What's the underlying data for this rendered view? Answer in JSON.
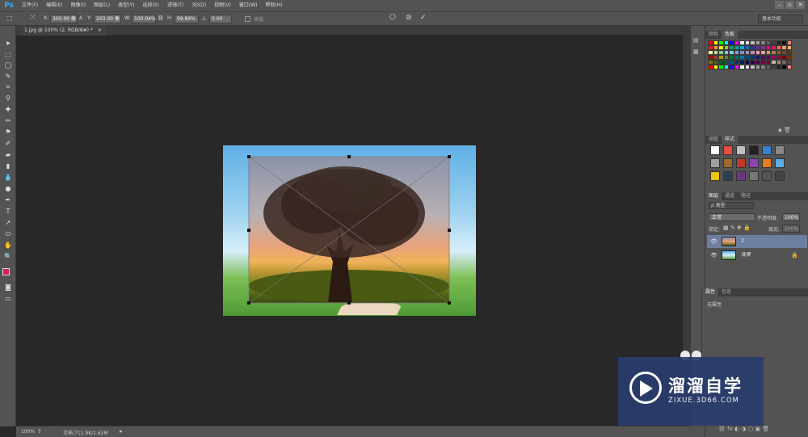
{
  "app": {
    "logo": "Ps",
    "colors": {
      "accent": "#3fa9f5",
      "chrome": "#535353",
      "canvas_bg": "#282828",
      "fg_color": "#d81b60",
      "bg_color": "#ffffff"
    }
  },
  "menu": [
    "文件(F)",
    "编辑(E)",
    "图像(I)",
    "图层(L)",
    "类型(Y)",
    "选择(S)",
    "滤镜(T)",
    "3D(D)",
    "视图(V)",
    "窗口(W)",
    "帮助(H)"
  ],
  "options": {
    "x_label": "X:",
    "x_value": "300.00 像",
    "y_label": "Y:",
    "y_value": "203.00 像",
    "w_label": "W:",
    "w_value": "100.04%",
    "h_label": "H:",
    "h_value": "99.89%",
    "angle_label": "△",
    "angle_value": "0.00",
    "interp_label": "插值",
    "workspace": "基本功能"
  },
  "document": {
    "tab": "1.jpg @ 100% (2, RGB/8#) *",
    "close": "×"
  },
  "status": {
    "zoom": "100%",
    "doc_info": "文档:711.9K/1.62M"
  },
  "panels": {
    "swatch_tabs": [
      "颜色",
      "色板"
    ],
    "style_tabs": [
      "调整",
      "样式"
    ],
    "layer_tabs": [
      "图层",
      "通道",
      "路径"
    ],
    "kind_label": "ρ 类型",
    "blend_mode": "正常",
    "opacity_label": "不透明度:",
    "opacity_value": "100%",
    "lock_label": "锁定:",
    "fill_label": "填充:",
    "fill_value": "100%",
    "layers": [
      {
        "name": "2"
      },
      {
        "name": "背景"
      }
    ],
    "props_tabs": [
      "属性",
      "信息"
    ],
    "props_text": "无属性"
  },
  "watermark": {
    "title": "溜溜自学",
    "url": "ZIXUE.3D66.COM"
  }
}
